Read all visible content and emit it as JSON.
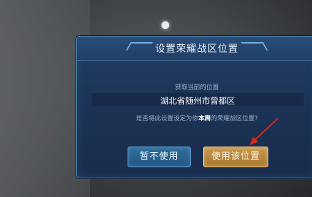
{
  "dialog": {
    "title": "设置荣耀战区位置",
    "current_label": "获取当前的位置",
    "location": "湖北省随州市曾都区",
    "question_prefix": "是否将此设置设定为你",
    "question_bold": "本周",
    "question_suffix": "的荣耀战区位置?",
    "cancel_label": "暂不使用",
    "confirm_label": "使用该位置"
  },
  "colors": {
    "accent_blue": "#5da7d6",
    "confirm_gold": "#c99a52",
    "arrow_red": "#e0241b"
  }
}
